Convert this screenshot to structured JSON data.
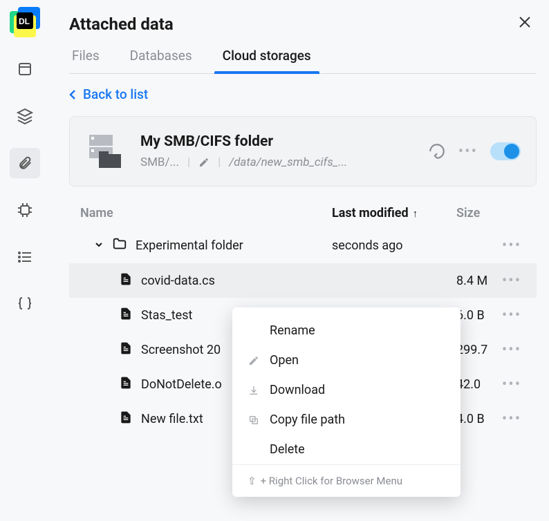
{
  "header": {
    "title": "Attached data"
  },
  "tabs": {
    "files": "Files",
    "databases": "Databases",
    "cloud": "Cloud storages"
  },
  "back": {
    "label": "Back to list"
  },
  "storage": {
    "name": "My SMB/CIFS folder",
    "type": "SMB/...",
    "path": "/data/new_smb_cifs_..."
  },
  "columns": {
    "name": "Name",
    "modified": "Last modified",
    "size": "Size"
  },
  "rows": {
    "folder": {
      "name": "Experimental folder",
      "modified": "seconds ago",
      "size": ""
    },
    "r1": {
      "name": "covid-data.cs",
      "size": "8.4 M"
    },
    "r2": {
      "name": "Stas_test",
      "size": "6.0 B"
    },
    "r3": {
      "name": "Screenshot 20",
      "size": "299.7"
    },
    "r4": {
      "name": "DoNotDelete.o",
      "size": "42.0"
    },
    "r5": {
      "name": "New file.txt",
      "size": "4.0 B"
    }
  },
  "context_menu": {
    "rename": "Rename",
    "open": "Open",
    "download": "Download",
    "copy_path": "Copy file path",
    "delete": "Delete",
    "footer": "+ Right Click for Browser Menu"
  }
}
